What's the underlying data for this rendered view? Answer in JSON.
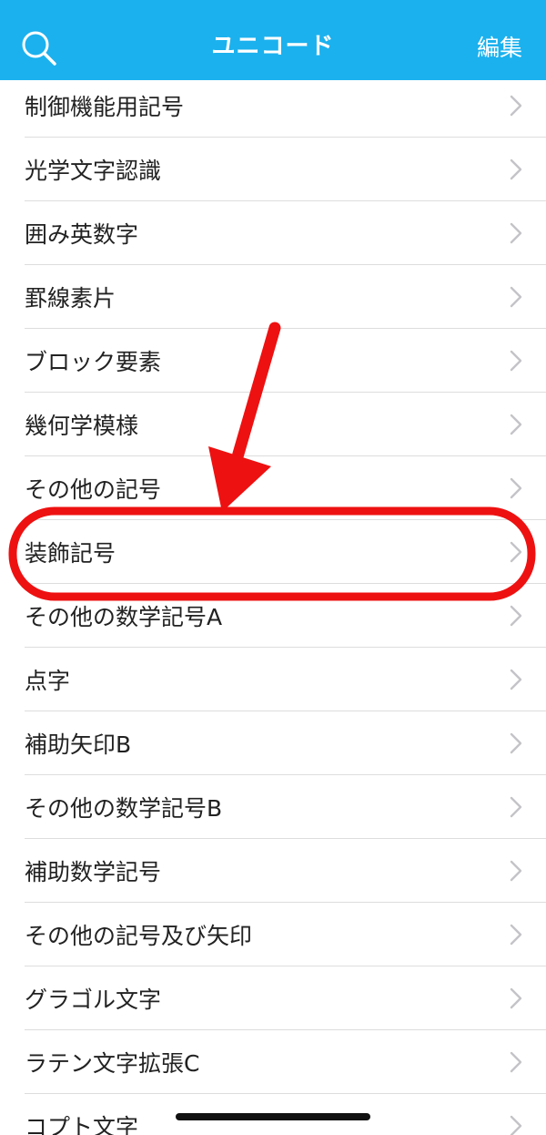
{
  "header": {
    "title": "ユニコード",
    "edit_label": "編集",
    "background_color": "#1bb1ee",
    "search_icon": "search-icon"
  },
  "list": {
    "items": [
      {
        "label": "制御機能用記号"
      },
      {
        "label": "光学文字認識"
      },
      {
        "label": "囲み英数字"
      },
      {
        "label": "罫線素片"
      },
      {
        "label": "ブロック要素"
      },
      {
        "label": "幾何学模様"
      },
      {
        "label": "その他の記号"
      },
      {
        "label": "装飾記号",
        "highlighted": true
      },
      {
        "label": "その他の数学記号A"
      },
      {
        "label": "点字"
      },
      {
        "label": "補助矢印B"
      },
      {
        "label": "その他の数学記号B"
      },
      {
        "label": "補助数学記号"
      },
      {
        "label": "その他の記号及び矢印"
      },
      {
        "label": "グラゴル文字"
      },
      {
        "label": "ラテン文字拡張C"
      },
      {
        "label": "コプト文字"
      }
    ],
    "chevron_icon": "chevron-right-icon"
  },
  "annotation": {
    "color": "#ee1111",
    "target": "装飾記号"
  }
}
